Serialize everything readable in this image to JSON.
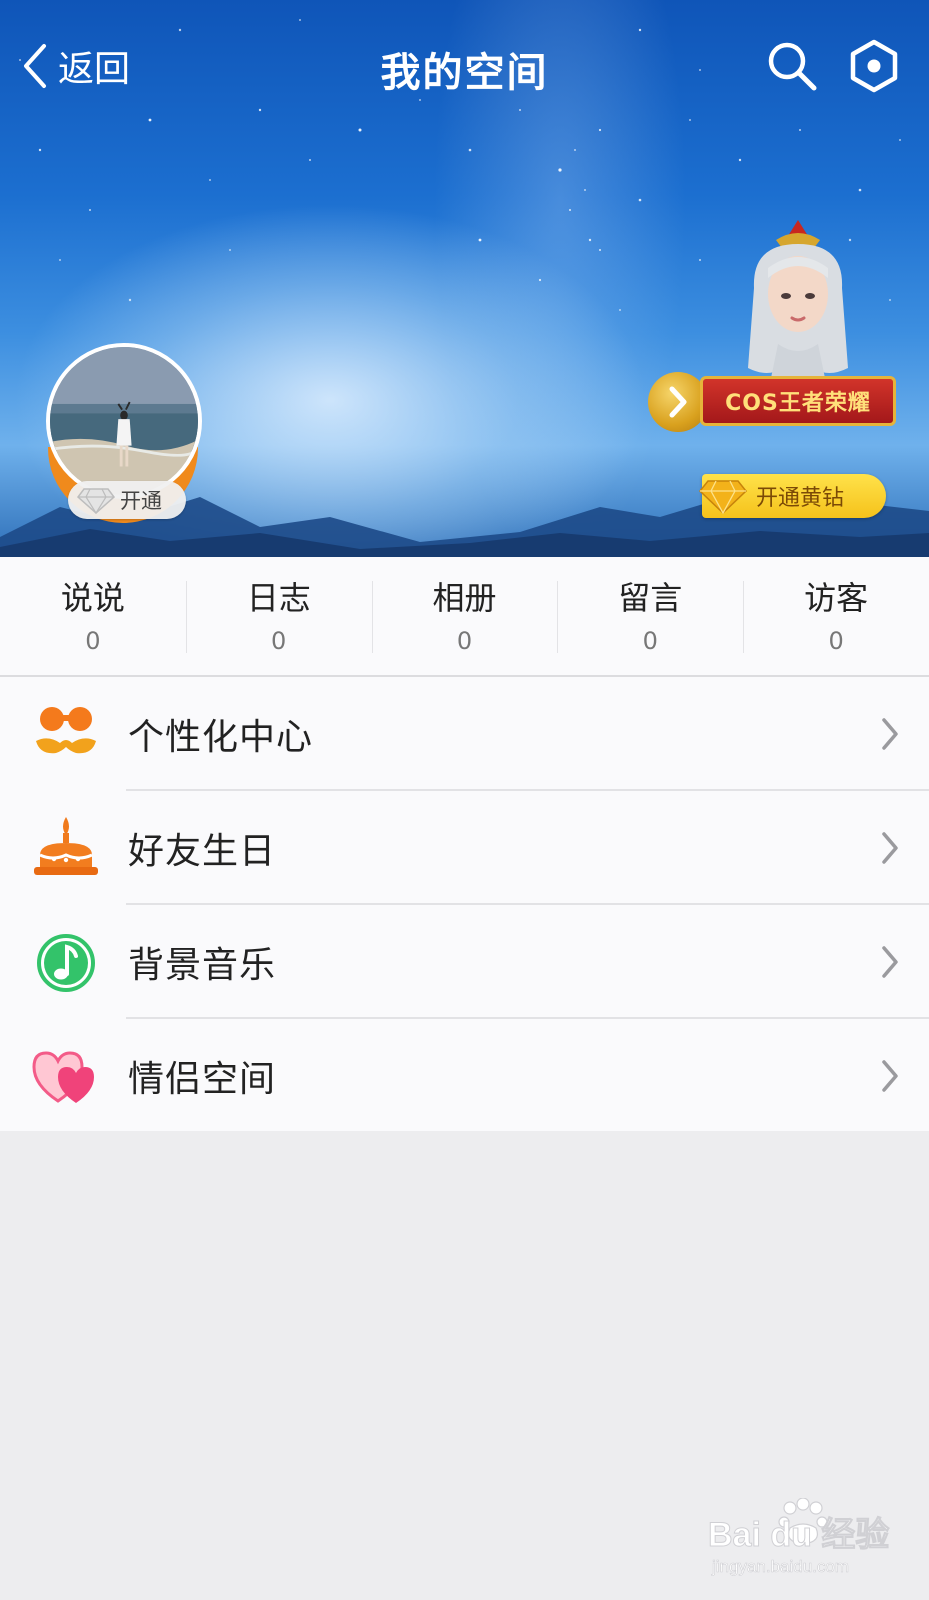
{
  "header": {
    "back_label": "返回",
    "title": "我的空间"
  },
  "profile": {
    "open_badge_label": "开通"
  },
  "promo": {
    "cos_label": "COS王者荣耀",
    "vip_label": "开通黄钻"
  },
  "stats": [
    {
      "label": "说说",
      "count": "0"
    },
    {
      "label": "日志",
      "count": "0"
    },
    {
      "label": "相册",
      "count": "0"
    },
    {
      "label": "留言",
      "count": "0"
    },
    {
      "label": "访客",
      "count": "0"
    }
  ],
  "menu": [
    {
      "label": "个性化中心",
      "icon": "mustache-icon"
    },
    {
      "label": "好友生日",
      "icon": "birthday-cake-icon"
    },
    {
      "label": "背景音乐",
      "icon": "music-note-icon"
    },
    {
      "label": "情侣空间",
      "icon": "hearts-icon"
    }
  ],
  "watermark": {
    "brand": "Bai du 经验",
    "url": "jingyan.baidu.com"
  },
  "colors": {
    "sky_blue": "#1c6fd0",
    "avatar_ring": "#f08a1c",
    "vip_yellow": "#f5c21b",
    "cos_red": "#a3181a",
    "page_bg": "#ededef"
  }
}
